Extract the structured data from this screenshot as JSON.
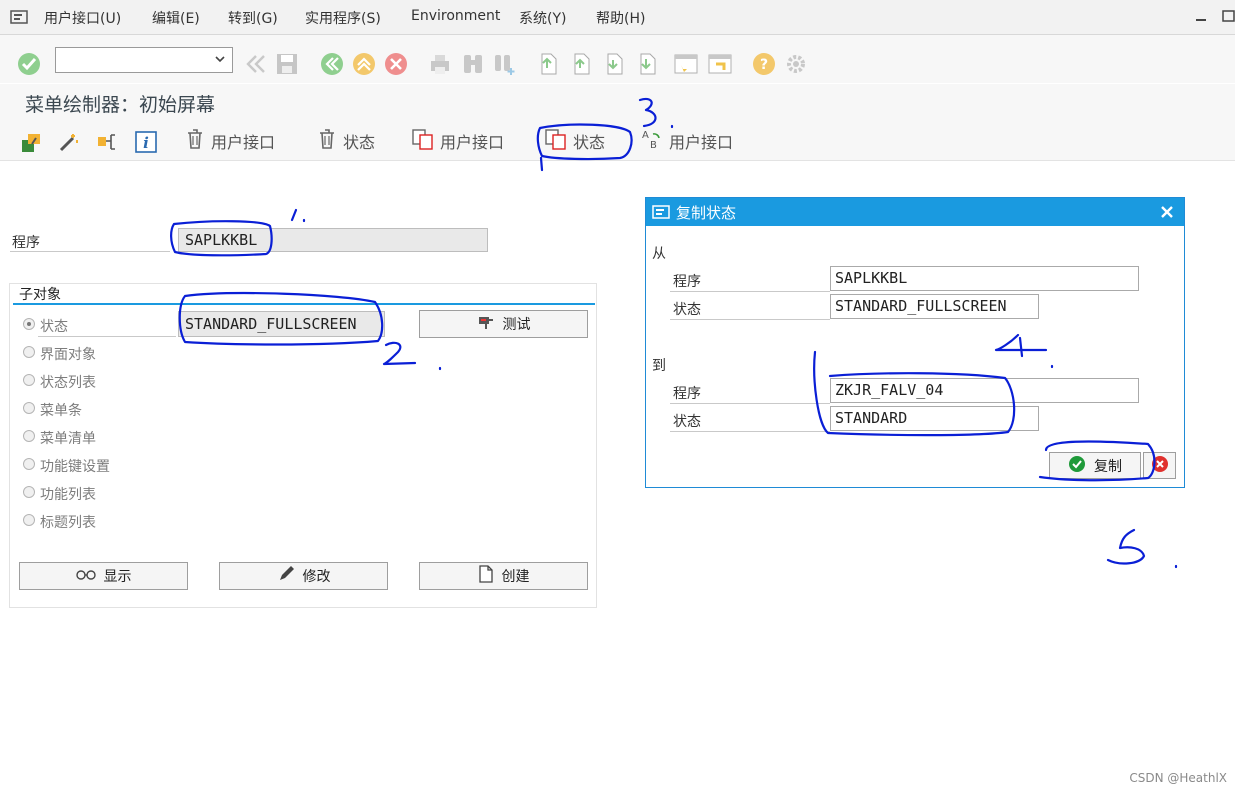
{
  "menubar": {
    "items": [
      "用户接口(U)",
      "编辑(E)",
      "转到(G)",
      "实用程序(S)",
      "Environment",
      "系统(Y)",
      "帮助(H)"
    ]
  },
  "toolbar": {
    "command_field_value": "",
    "icons": [
      "enter-icon",
      "back-icon",
      "save-icon",
      "back-green-icon",
      "exit-icon",
      "cancel-icon",
      "print-icon",
      "find-icon",
      "find-next-icon",
      "first-page-icon",
      "prev-page-icon",
      "next-page-icon",
      "last-page-icon",
      "new-session-icon",
      "shortcut-icon",
      "help-icon",
      "settings-icon"
    ]
  },
  "page": {
    "title": "菜单绘制器：初始屏幕"
  },
  "app_toolbar": {
    "delete_ui_label": "用户接口",
    "delete_status_label": "状态",
    "copy_ui_label": "用户接口",
    "copy_status_label": "状态",
    "rename_ui_label": "用户接口"
  },
  "main": {
    "program_label": "程序",
    "program_value": "SAPLKKBL",
    "subobjects_title": "子对象",
    "radios": [
      {
        "label": "状态",
        "selected": true
      },
      {
        "label": "界面对象",
        "selected": false
      },
      {
        "label": "状态列表",
        "selected": false
      },
      {
        "label": "菜单条",
        "selected": false
      },
      {
        "label": "菜单清单",
        "selected": false
      },
      {
        "label": "功能键设置",
        "selected": false
      },
      {
        "label": "功能列表",
        "selected": false
      },
      {
        "label": "标题列表",
        "selected": false
      }
    ],
    "status_value": "STANDARD_FULLSCREEN",
    "test_button": "测试",
    "display_button": "显示",
    "change_button": "修改",
    "create_button": "创建"
  },
  "dialog": {
    "title": "复制状态",
    "from_label": "从",
    "from_program_label": "程序",
    "from_program_value": "SAPLKKBL",
    "from_status_label": "状态",
    "from_status_value": "STANDARD_FULLSCREEN",
    "to_label": "到",
    "to_program_label": "程序",
    "to_program_value": "ZKJR_FALV_04",
    "to_status_label": "状态",
    "to_status_value": "STANDARD",
    "copy_button": "复制"
  },
  "watermark": "CSDN @HeathlX",
  "colors": {
    "dialog_title_bg": "#1a9ae0",
    "annotation_ink": "#0a1fd6",
    "enter_green": "#3cb54a",
    "cancel_red": "#e0312e"
  }
}
